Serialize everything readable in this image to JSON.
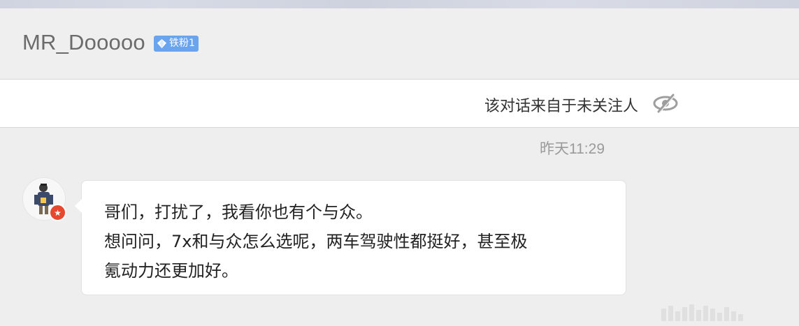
{
  "header": {
    "username": "MR_Dooooo",
    "fan_badge": {
      "label": "铁粉1",
      "icon": "diamond-icon",
      "color": "#6aa4ee"
    }
  },
  "notice": {
    "text": "该对话来自于未关注人",
    "icon": "eye-slash-icon"
  },
  "conversation": {
    "timestamp": "昨天11:29",
    "messages": [
      {
        "sender_avatar": "avatar",
        "verified_badge": "verified-icon",
        "lines": [
          "哥们，打扰了，我看你也有个与众。",
          "想问问，7x和与众怎么选呢，两车驾驶性都挺好，甚至极",
          "氪动力还更加好。"
        ]
      }
    ]
  },
  "colors": {
    "background": "#eeeeee",
    "bubble": "#ffffff",
    "badge_accent": "#e64a2e"
  }
}
